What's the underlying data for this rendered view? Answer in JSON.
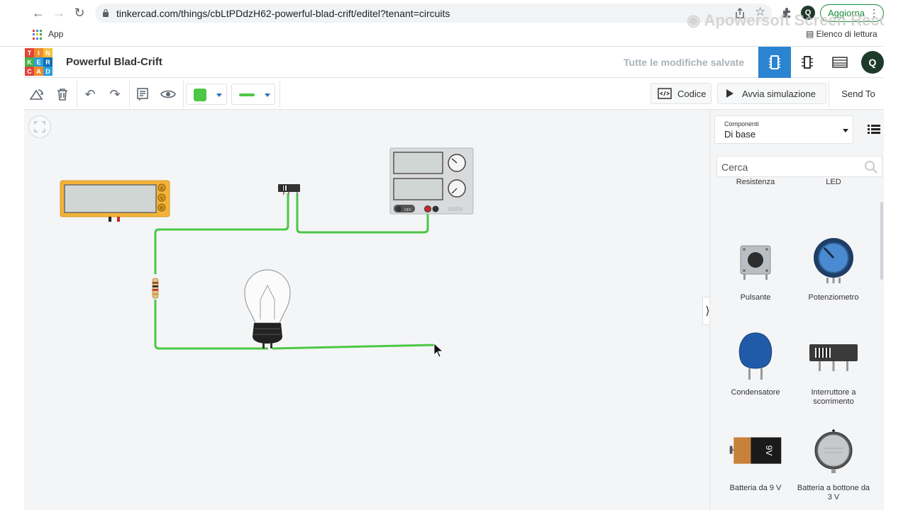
{
  "browser": {
    "url": "tinkercad.com/things/cbLtPDdzH62-powerful-blad-crift/editel?tenant=circuits",
    "update_label": "Aggiorna",
    "apps_label": "App",
    "reading_list_label": "Elenco di lettura",
    "watermark": "Apowersoft Screen Recorder",
    "icons": [
      "back-icon",
      "forward-icon",
      "reload-icon",
      "lock-icon",
      "share-icon",
      "star-icon",
      "puzzle-icon",
      "profile-icon"
    ]
  },
  "app": {
    "logo_letters": [
      "T",
      "I",
      "N",
      "K",
      "E",
      "R",
      "C",
      "A",
      "D"
    ],
    "logo_colors": [
      "#e2443a",
      "#ef8a2b",
      "#f6c23b",
      "#45b24a",
      "#2b9fd9",
      "#0c6eb4",
      "#e2443a",
      "#ef8a2b",
      "#2b9fd9"
    ],
    "design_title": "Powerful Blad-Crift",
    "save_status": "Tutte le modifiche salvate",
    "avatar_initial": "Q",
    "accent": "#2a84d2"
  },
  "toolbar": {
    "code_label": "Codice",
    "simulate_label": "Avvia simulazione",
    "send_label": "Send To",
    "wire_color": "#4cc746"
  },
  "sidebar": {
    "components_label": "Componenti",
    "components_value": "Di base",
    "search_placeholder": "Cerca",
    "items": [
      {
        "label": "Resistenza",
        "icon": "resistor-icon"
      },
      {
        "label": "LED",
        "icon": "led-icon"
      },
      {
        "label": "Pulsante",
        "icon": "pushbutton-icon"
      },
      {
        "label": "Potenziometro",
        "icon": "potentiometer-icon"
      },
      {
        "label": "Condensatore",
        "icon": "capacitor-icon"
      },
      {
        "label": "Interruttore a scorrimento",
        "icon": "slide-switch-icon"
      },
      {
        "label": "Batteria da 9 V",
        "icon": "battery-9v-icon"
      },
      {
        "label": "Batteria a bottone da 3 V",
        "icon": "coin-battery-icon"
      }
    ],
    "battery_text": "9V"
  },
  "canvas": {
    "components": [
      "multimeter",
      "slide-switch",
      "power-supply",
      "resistor",
      "light-bulb"
    ],
    "multimeter_buttons": [
      "A",
      "V",
      "R"
    ],
    "power_supply_off": "OFF"
  }
}
